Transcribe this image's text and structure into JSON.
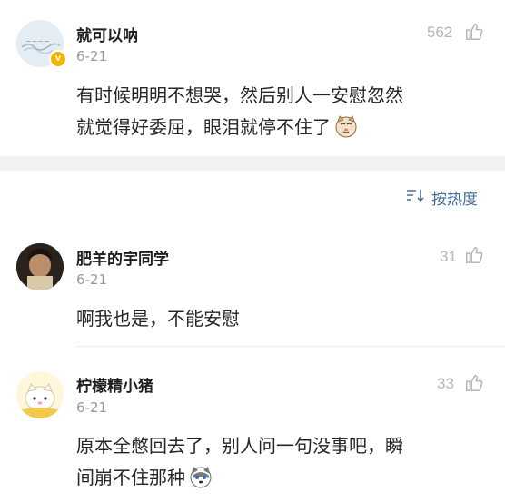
{
  "top_comment": {
    "author": "就可以呐",
    "date": "6-21",
    "likes": "562",
    "text_line1": "有时候明明不想哭，然后别人一安慰忽然",
    "text_line2": "就觉得好委屈，眼泪就停不住了"
  },
  "sort": {
    "label": "按热度",
    "icon": "sort-icon"
  },
  "replies": [
    {
      "author": "肥羊的宇同学",
      "date": "6-21",
      "likes": "31",
      "text": "啊我也是，不能安慰"
    },
    {
      "author": "柠檬精小猪",
      "date": "6-21",
      "likes": "33",
      "text_line1": "原本全憋回去了，别人问一句没事吧，瞬",
      "text_line2": "间崩不住那种"
    }
  ],
  "colors": {
    "accent_link": "#4a6e9a",
    "verified_badge": "#f5b400",
    "muted": "#9a9a9a"
  }
}
